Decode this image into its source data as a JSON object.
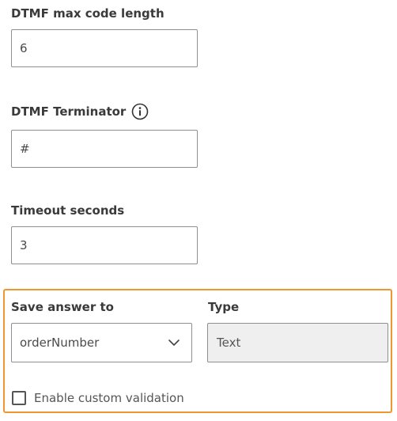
{
  "dtmf_max_code_length": {
    "label": "DTMF max code length",
    "value": "6"
  },
  "dtmf_terminator": {
    "label": "DTMF Terminator",
    "value": "#",
    "icon": "info-icon"
  },
  "timeout_seconds": {
    "label": "Timeout seconds",
    "value": "3"
  },
  "save_answer": {
    "label": "Save answer to",
    "selected": "orderNumber",
    "icon": "chevron-down-icon"
  },
  "type": {
    "label": "Type",
    "value": "Text"
  },
  "custom_validation": {
    "label": "Enable custom validation",
    "checked": false
  },
  "colors": {
    "highlight_border": "#f0962e",
    "field_border": "#8f8f8f",
    "readonly_bg": "#efefef"
  }
}
